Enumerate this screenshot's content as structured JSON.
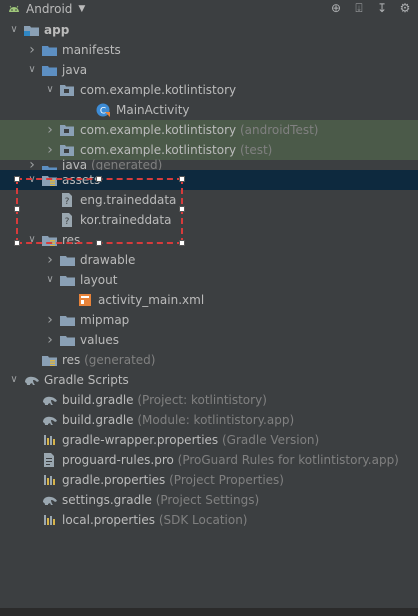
{
  "header": {
    "title": "Android",
    "dropdown_glyph": "▼",
    "tools": [
      {
        "name": "locate-icon",
        "glyph": "⊕"
      },
      {
        "name": "collapse-all-icon",
        "glyph": "⍗"
      },
      {
        "name": "expand-icon",
        "glyph": "↧"
      },
      {
        "name": "gear-icon",
        "glyph": "⚙"
      }
    ]
  },
  "tree": [
    {
      "label": "app",
      "sub": "",
      "indent": 0,
      "arrow": "v",
      "icon": "module-folder",
      "bold": true
    },
    {
      "label": "manifests",
      "sub": "",
      "indent": 1,
      "arrow": ">",
      "icon": "folder-blue"
    },
    {
      "label": "java",
      "sub": "",
      "indent": 1,
      "arrow": "v",
      "icon": "folder-blue"
    },
    {
      "label": "com.example.kotlintistory",
      "sub": "",
      "indent": 2,
      "arrow": "v",
      "icon": "package"
    },
    {
      "label": "MainActivity",
      "sub": "",
      "indent": 4,
      "arrow": "",
      "icon": "kotlin-class"
    },
    {
      "label": "com.example.kotlintistory",
      "sub": " (androidTest)",
      "indent": 2,
      "arrow": ">",
      "icon": "package",
      "bg": "green"
    },
    {
      "label": "com.example.kotlintistory",
      "sub": " (test)",
      "indent": 2,
      "arrow": ">",
      "icon": "package",
      "bg": "green"
    },
    {
      "label": "java",
      "sub": " (generated)",
      "indent": 1,
      "arrow": ">",
      "icon": "folder-gen",
      "cut": true
    },
    {
      "label": "assets",
      "sub": "",
      "indent": 1,
      "arrow": "v",
      "icon": "folder-res",
      "bg": "sel"
    },
    {
      "label": "eng.traineddata",
      "sub": "",
      "indent": 2,
      "arrow": "",
      "icon": "unknown-file"
    },
    {
      "label": "kor.traineddata",
      "sub": "",
      "indent": 2,
      "arrow": "",
      "icon": "unknown-file"
    },
    {
      "label": "res",
      "sub": "",
      "indent": 1,
      "arrow": "v",
      "icon": "folder-res"
    },
    {
      "label": "drawable",
      "sub": "",
      "indent": 2,
      "arrow": ">",
      "icon": "folder"
    },
    {
      "label": "layout",
      "sub": "",
      "indent": 2,
      "arrow": "v",
      "icon": "folder"
    },
    {
      "label": "activity_main.xml",
      "sub": "",
      "indent": 3,
      "arrow": "",
      "icon": "layout-xml"
    },
    {
      "label": "mipmap",
      "sub": "",
      "indent": 2,
      "arrow": ">",
      "icon": "folder"
    },
    {
      "label": "values",
      "sub": "",
      "indent": 2,
      "arrow": ">",
      "icon": "folder"
    },
    {
      "label": "res",
      "sub": " (generated)",
      "indent": 1,
      "arrow": "",
      "icon": "folder-res"
    },
    {
      "label": "Gradle Scripts",
      "sub": "",
      "indent": 0,
      "arrow": "v",
      "icon": "gradle"
    },
    {
      "label": "build.gradle",
      "sub": " (Project: kotlintistory)",
      "indent": 1,
      "arrow": "",
      "icon": "gradle"
    },
    {
      "label": "build.gradle",
      "sub": " (Module: kotlintistory.app)",
      "indent": 1,
      "arrow": "",
      "icon": "gradle"
    },
    {
      "label": "gradle-wrapper.properties",
      "sub": " (Gradle Version)",
      "indent": 1,
      "arrow": "",
      "icon": "properties"
    },
    {
      "label": "proguard-rules.pro",
      "sub": " (ProGuard Rules for kotlintistory.app)",
      "indent": 1,
      "arrow": "",
      "icon": "text-file"
    },
    {
      "label": "gradle.properties",
      "sub": " (Project Properties)",
      "indent": 1,
      "arrow": "",
      "icon": "properties"
    },
    {
      "label": "settings.gradle",
      "sub": " (Project Settings)",
      "indent": 1,
      "arrow": "",
      "icon": "gradle"
    },
    {
      "label": "local.properties",
      "sub": " (SDK Location)",
      "indent": 1,
      "arrow": "",
      "icon": "properties"
    }
  ],
  "colors": {
    "background": "#3c3f41",
    "selection": "#0d293e",
    "test_rows": "#4b5a49",
    "annotation_box": "#d73b3b"
  }
}
